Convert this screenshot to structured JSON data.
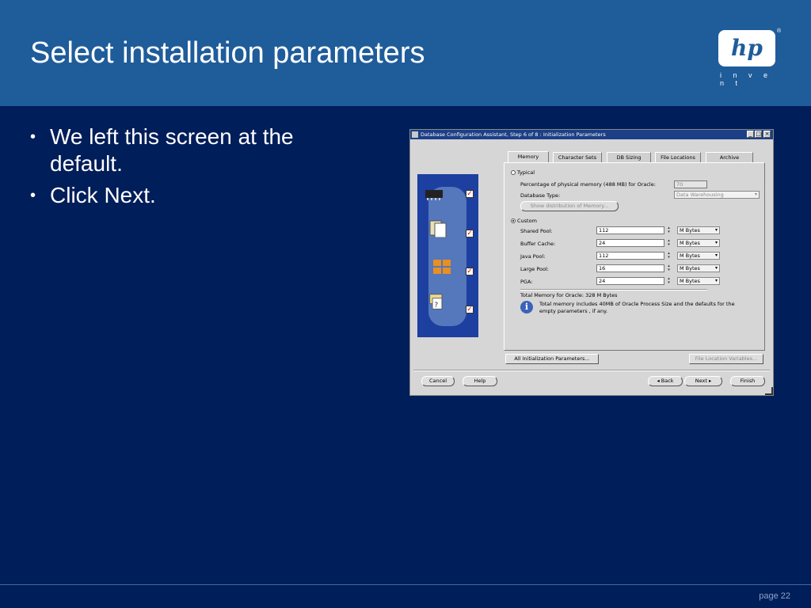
{
  "slide": {
    "title": "Select installation parameters",
    "bullets": [
      "We left this screen at the default.",
      "Click Next."
    ],
    "page": "page 22",
    "logo": {
      "brand": "hp",
      "tagline": "i n v e n t",
      "reg": "®"
    }
  },
  "window": {
    "title": "Database Configuration Assistant, Step 6 of 8 : Initialization Parameters",
    "controls": [
      "_",
      "□",
      "×"
    ],
    "tabs": [
      "Memory",
      "Character Sets",
      "DB Sizing",
      "File Locations",
      "Archive"
    ],
    "typical": {
      "label": "Typical",
      "percent_label": "Percentage of physical memory (488 MB) for Oracle:",
      "percent_value": "70",
      "dbtype_label": "Database Type:",
      "dbtype_value": "Data Warehousing",
      "show_button": "Show distribution of Memory..."
    },
    "custom": {
      "label": "Custom",
      "rows": [
        {
          "label": "Shared Pool:",
          "value": "112",
          "unit": "M Bytes"
        },
        {
          "label": "Buffer Cache:",
          "value": "24",
          "unit": "M Bytes"
        },
        {
          "label": "Java Pool:",
          "value": "112",
          "unit": "M Bytes"
        },
        {
          "label": "Large Pool:",
          "value": "16",
          "unit": "M Bytes"
        },
        {
          "label": "PGA:",
          "value": "24",
          "unit": "M Bytes"
        }
      ],
      "total": "Total Memory for Oracle:  328 M Bytes",
      "info_line1": "Total memory includes 40MB of Oracle Process Size and the defaults for the",
      "info_line2": "empty parameters , if any."
    },
    "buttons": {
      "all_params": "All Initialization Parameters...",
      "file_vars": "File Location Variables...",
      "cancel": "Cancel",
      "help": "Help",
      "back": "Back",
      "next": "Next",
      "finish": "Finish"
    },
    "colors": {
      "titlebar": "#1c3f86",
      "side": "#1c3fa0"
    }
  }
}
